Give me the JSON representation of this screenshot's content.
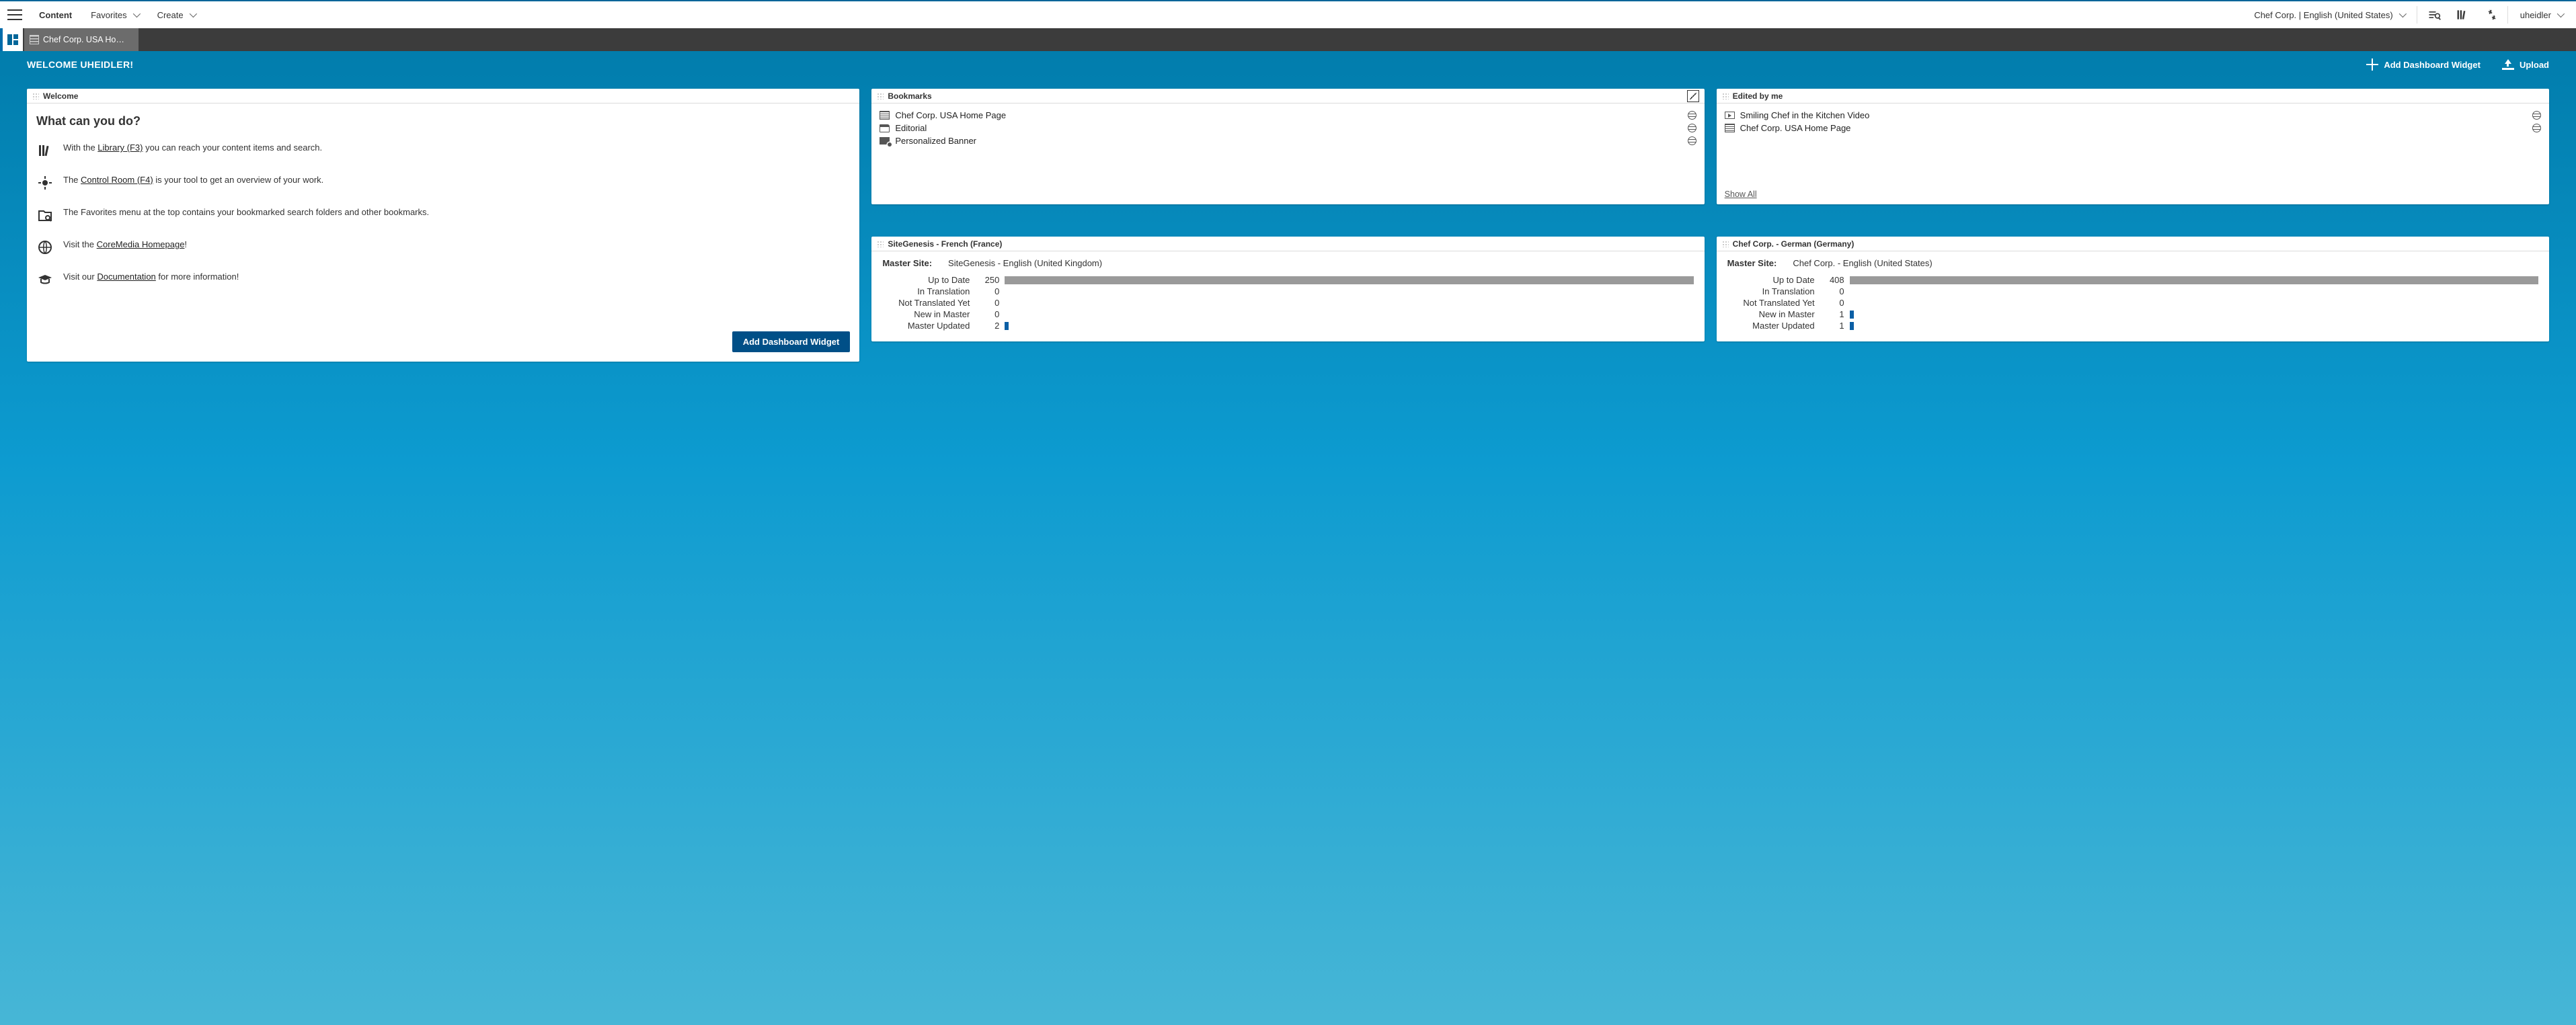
{
  "topbar": {
    "content": "Content",
    "favorites": "Favorites",
    "create": "Create",
    "site_locale": "Chef Corp. | English (United States)",
    "user": "uheidler"
  },
  "tabs": {
    "open": {
      "label": "Chef Corp. USA Home Pa…"
    }
  },
  "banner": {
    "welcome": "WELCOME UHEIDLER!",
    "add_widget": "Add Dashboard Widget",
    "upload": "Upload"
  },
  "widgets": {
    "welcome": {
      "title": "Welcome",
      "heading": "What can you do?",
      "library_pre": "With the ",
      "library_link": "Library (F3)",
      "library_post": " you can reach your content items and search.",
      "control_pre": "The ",
      "control_link": "Control Room (F4)",
      "control_post": " is your tool to get an overview of your work.",
      "favorites": "The Favorites menu at the top contains your bookmarked search folders and other bookmarks.",
      "home_pre": "Visit the ",
      "home_link": "CoreMedia Homepage",
      "home_post": "!",
      "docs_pre": "Visit our ",
      "docs_link": "Documentation",
      "docs_post": " for more information!",
      "cta": "Add Dashboard Widget"
    },
    "bookmarks": {
      "title": "Bookmarks",
      "items": [
        {
          "icon": "page",
          "label": "Chef Corp. USA Home Page"
        },
        {
          "icon": "folder",
          "label": "Editorial"
        },
        {
          "icon": "banner",
          "label": "Personalized Banner"
        }
      ]
    },
    "edited": {
      "title": "Edited by me",
      "items": [
        {
          "icon": "video",
          "label": "Smiling Chef in the Kitchen Video"
        },
        {
          "icon": "page",
          "label": "Chef Corp. USA Home Page"
        }
      ],
      "show_all": "Show All"
    },
    "trans1": {
      "title": "SiteGenesis - French (France)",
      "master_label": "Master Site:",
      "master_value": "SiteGenesis - English (United Kingdom)",
      "stats": {
        "up_to_date": {
          "label": "Up to Date",
          "value": 250,
          "max": 250,
          "color": "gray"
        },
        "in_translation": {
          "label": "In Translation",
          "value": 0,
          "max": 250,
          "color": "blue"
        },
        "not_translated": {
          "label": "Not Translated Yet",
          "value": 0,
          "max": 250,
          "color": "blue"
        },
        "new_in_master": {
          "label": "New in Master",
          "value": 0,
          "max": 250,
          "color": "blue"
        },
        "master_updated": {
          "label": "Master Updated",
          "value": 2,
          "max": 250,
          "color": "blue"
        }
      }
    },
    "trans2": {
      "title": "Chef Corp. - German (Germany)",
      "master_label": "Master Site:",
      "master_value": "Chef Corp. - English (United States)",
      "stats": {
        "up_to_date": {
          "label": "Up to Date",
          "value": 408,
          "max": 408,
          "color": "gray"
        },
        "in_translation": {
          "label": "In Translation",
          "value": 0,
          "max": 408,
          "color": "blue"
        },
        "not_translated": {
          "label": "Not Translated Yet",
          "value": 0,
          "max": 408,
          "color": "blue"
        },
        "new_in_master": {
          "label": "New in Master",
          "value": 1,
          "max": 408,
          "color": "blue"
        },
        "master_updated": {
          "label": "Master Updated",
          "value": 1,
          "max": 408,
          "color": "blue"
        }
      }
    }
  }
}
